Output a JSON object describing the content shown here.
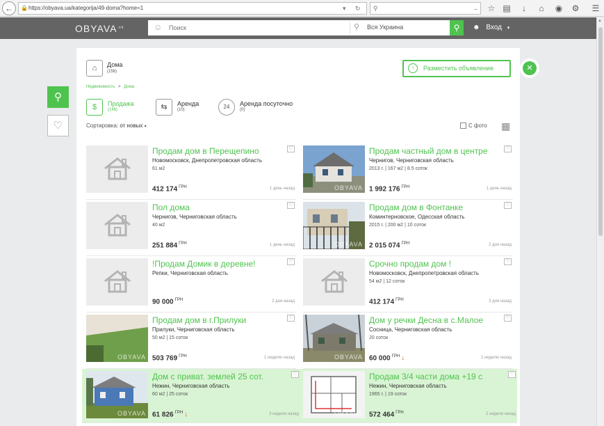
{
  "browser": {
    "url": "https://obyava.ua/kategorija/49-doma?home=1",
    "search_placeholder": ""
  },
  "header": {
    "logo": "OBYAVA",
    "logo_sup": ".ua",
    "search_placeholder": "Поиск",
    "region": "Вся Украина",
    "login": "Вход"
  },
  "category": {
    "title": "Дома",
    "count": "(156)",
    "post_button": "Разместить объявление"
  },
  "breadcrumb": {
    "item1": "Недвижимость",
    "sep": ">",
    "item2": "Дома"
  },
  "deal_types": [
    {
      "label": "Продажа",
      "count": "(146)",
      "icon": "dollar-icon"
    },
    {
      "label": "Аренда",
      "count": "(10)",
      "icon": "swap-arrows-icon"
    },
    {
      "label": "Аренда посуточно",
      "count": "(0)",
      "icon": "24h-icon"
    }
  ],
  "sort": {
    "label": "Сортировка:",
    "value": "от новых"
  },
  "photo_filter": "С фото",
  "listings": [
    {
      "title": "Продам дом в Перещепино",
      "location": "Новомосковск, Днепропетровская область",
      "specs": "61 м2",
      "price": "412 174",
      "currency": "ГРН",
      "date": "1 день назад",
      "thumb": "placeholder",
      "highlight": false,
      "price_down": false
    },
    {
      "title": "Продам частный дом в центре",
      "location": "Чернигов, Черниговская область",
      "specs": "2013 г. | 167 м2 | 8.5 соток",
      "price": "1 992 176",
      "currency": "ГРН",
      "date": "1 день назад",
      "thumb": "house-white",
      "highlight": false,
      "price_down": false
    },
    {
      "title": "Пол дома",
      "location": "Чернигов, Черниговская область",
      "specs": "40 м2",
      "price": "251 884",
      "currency": "ГРН",
      "date": "1 день назад",
      "thumb": "placeholder",
      "highlight": false,
      "price_down": false
    },
    {
      "title": "Продам дом в Фонтанке",
      "location": "Коминтерновское, Одесская область",
      "specs": "2015 г. | 200 м2 | 10 соток",
      "price": "2 015 074",
      "currency": "ГРН",
      "date": "2 дня назад",
      "thumb": "house-gate",
      "highlight": false,
      "price_down": false
    },
    {
      "title": "!Продам Домик в деревне!",
      "location": "Репки, Черниговская область",
      "specs": "",
      "price": "90 000",
      "currency": "ГРН",
      "date": "2 дня назад",
      "thumb": "placeholder",
      "highlight": false,
      "price_down": false
    },
    {
      "title": "Срочно продам дом !",
      "location": "Новомосковск, Днепропетровская область",
      "specs": "54 м2 | 12 соток",
      "price": "412 174",
      "currency": "ГРН",
      "date": "3 дня назад",
      "thumb": "placeholder",
      "highlight": false,
      "price_down": false
    },
    {
      "title": "Продам дом в г.Прилуки",
      "location": "Прилуки, Черниговская область",
      "specs": "50 м2 | 15 соток",
      "price": "503 769",
      "currency": "ГРН",
      "date": "1 неделю назад",
      "thumb": "interior",
      "highlight": false,
      "price_down": false
    },
    {
      "title": "Дом у речки Десна в с.Малое",
      "location": "Сосница, Черниговская область",
      "specs": "20 соток",
      "price": "60 000",
      "currency": "ГРН",
      "date": "1 неделю назад",
      "thumb": "house-old",
      "highlight": false,
      "price_down": true
    },
    {
      "title": "Дом с приват. землей 25 сот.",
      "location": "Нежин, Черниговская область",
      "specs": "60 м2 | 25 соток",
      "price": "61 826",
      "currency": "ГРН",
      "date": "3 недели назад",
      "thumb": "house-blue",
      "highlight": true,
      "price_down": true
    },
    {
      "title": "Продам 3/4 части дома +19 с",
      "location": "Нежин, Черниговская область",
      "specs": "1965 г. | 19 соток",
      "price": "572 464",
      "currency": "ГРН",
      "date": "2 недели назад",
      "thumb": "floorplan",
      "highlight": true,
      "price_down": false
    }
  ],
  "watermark": "OBYAVA"
}
